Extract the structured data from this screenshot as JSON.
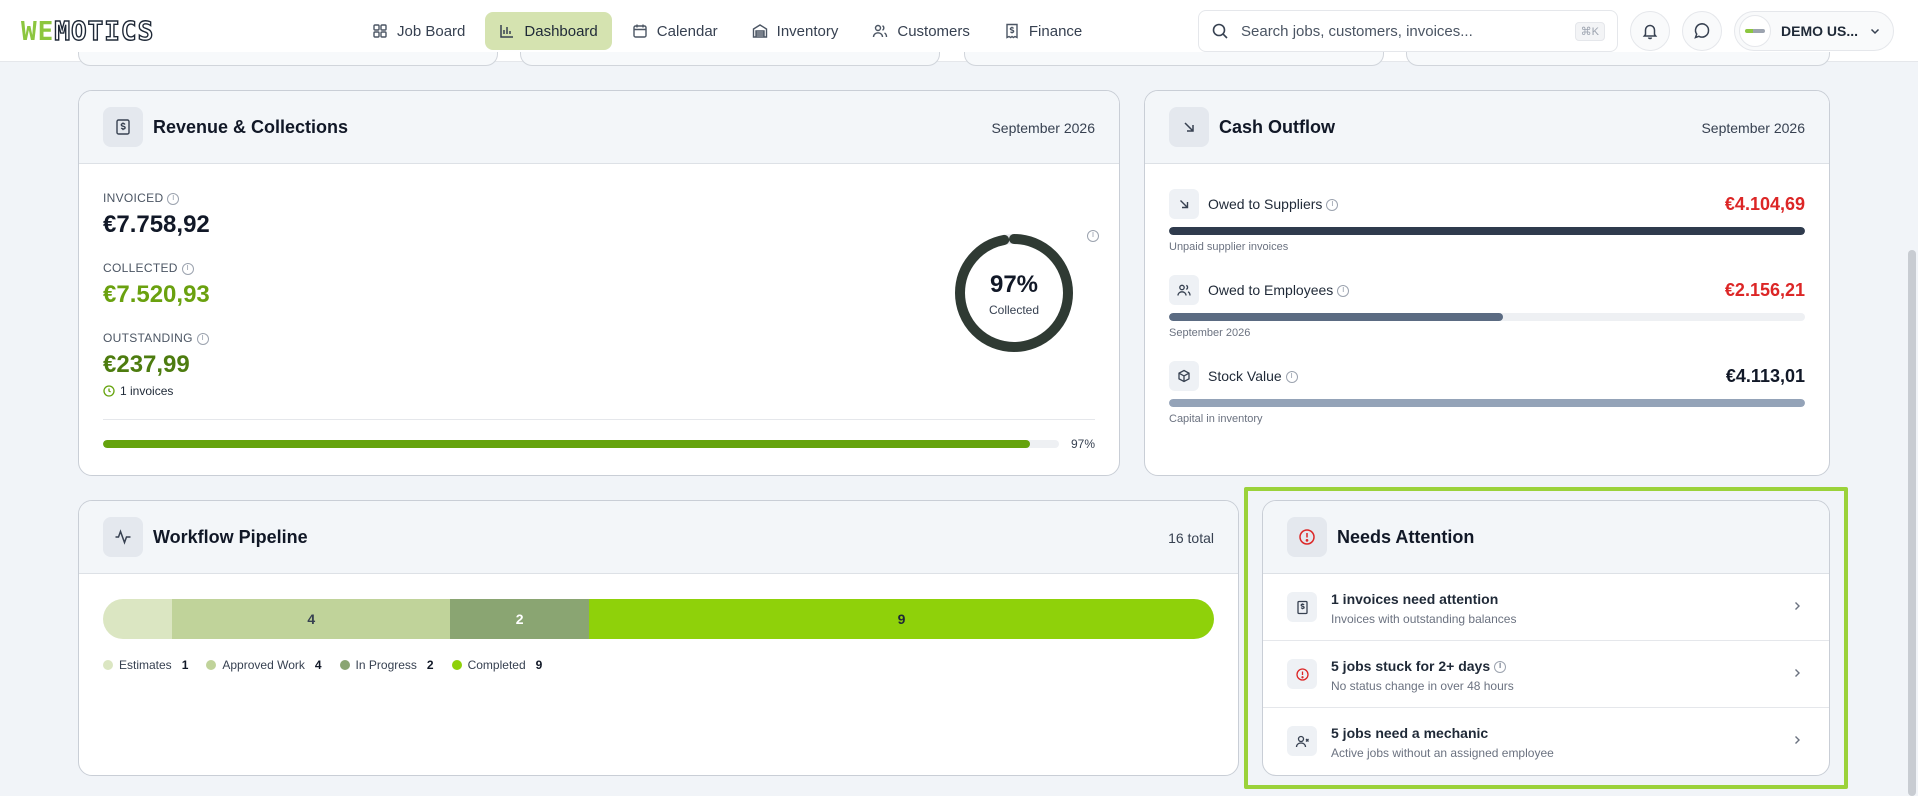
{
  "brand": {
    "logo_we": "WE",
    "logo_rest": "MOTICS"
  },
  "nav": {
    "items": [
      {
        "label": "Job Board",
        "icon": "grid-icon"
      },
      {
        "label": "Dashboard",
        "icon": "bar-chart-icon",
        "active": true
      },
      {
        "label": "Calendar",
        "icon": "calendar-icon"
      },
      {
        "label": "Inventory",
        "icon": "warehouse-icon"
      },
      {
        "label": "Customers",
        "icon": "users-icon"
      },
      {
        "label": "Finance",
        "icon": "receipt-icon"
      }
    ]
  },
  "search": {
    "placeholder": "Search jobs, customers, invoices...",
    "shortcut": "⌘K"
  },
  "user": {
    "name": "DEMO US..."
  },
  "revenue": {
    "title": "Revenue & Collections",
    "period": "September 2026",
    "invoiced_label": "INVOICED",
    "invoiced_value": "€7.758,92",
    "collected_label": "COLLECTED",
    "collected_value": "€7.520,93",
    "outstanding_label": "OUTSTANDING",
    "outstanding_value": "€237,99",
    "outstanding_note": "1 invoices",
    "ring_percent": "97%",
    "ring_label": "Collected",
    "ring_fraction": 0.97,
    "bar_percent_label": "97%",
    "bar_fraction": 0.97
  },
  "cash_outflow": {
    "title": "Cash Outflow",
    "period": "September 2026",
    "rows": [
      {
        "label": "Owed to Suppliers",
        "value": "€4.104,69",
        "sub": "Unpaid supplier invoices",
        "fraction": 1.0,
        "color": "#2f3b4d",
        "value_color": "#dc2626"
      },
      {
        "label": "Owed to Employees",
        "value": "€2.156,21",
        "sub": "September 2026",
        "fraction": 0.525,
        "color": "#5b6b82",
        "value_color": "#dc2626"
      },
      {
        "label": "Stock Value",
        "value": "€4.113,01",
        "sub": "Capital in inventory",
        "fraction": 1.0,
        "color": "#94a3b8",
        "value_color": "#111827"
      }
    ]
  },
  "pipeline": {
    "title": "Workflow Pipeline",
    "total": "16 total",
    "stages": [
      {
        "name": "Estimates",
        "count": 1,
        "label": "",
        "color": "#dbe6c2"
      },
      {
        "name": "Approved Work",
        "count": 4,
        "label": "4",
        "color": "#c0d39a"
      },
      {
        "name": "In Progress",
        "count": 2,
        "label": "2",
        "color": "#8aa572"
      },
      {
        "name": "Completed",
        "count": 9,
        "label": "9",
        "color": "#8fd10a"
      }
    ]
  },
  "attention": {
    "title": "Needs Attention",
    "items": [
      {
        "title": "1 invoices need attention",
        "sub": "Invoices with outstanding balances",
        "icon": "receipt-icon"
      },
      {
        "title": "5 jobs stuck for 2+ days",
        "sub": "No status change in over 48 hours",
        "icon": "alert-circle-icon"
      },
      {
        "title": "5 jobs need a mechanic",
        "sub": "Active jobs without an assigned employee",
        "icon": "user-x-icon"
      }
    ]
  },
  "colors": {
    "accent": "#8cc63f",
    "dark_ring": "#2f3a33",
    "green_text": "#6aa10f",
    "olive_text": "#4d7c0f"
  }
}
